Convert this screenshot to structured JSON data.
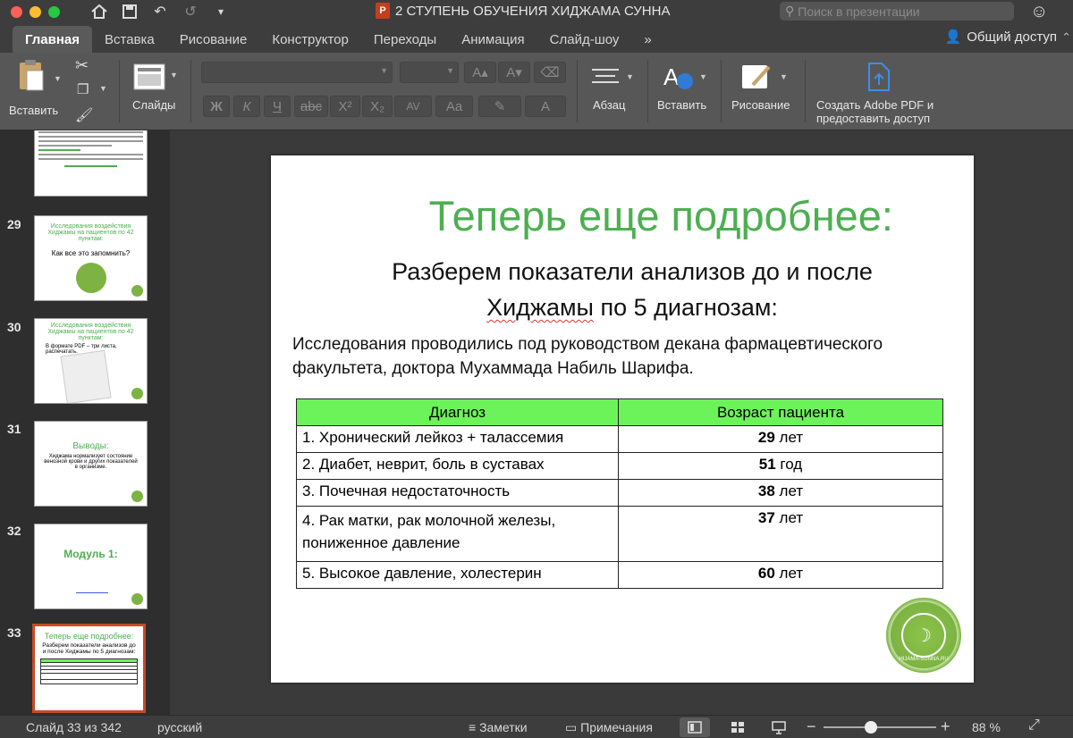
{
  "window": {
    "title": "2 СТУПЕНЬ ОБУЧЕНИЯ ХИДЖАМА СУННА",
    "app_badge": "P",
    "search_placeholder": "Поиск в презентации"
  },
  "tabs": [
    {
      "label": "Главная",
      "active": true
    },
    {
      "label": "Вставка"
    },
    {
      "label": "Рисование"
    },
    {
      "label": "Конструктор"
    },
    {
      "label": "Переходы"
    },
    {
      "label": "Анимация"
    },
    {
      "label": "Слайд-шоу"
    },
    {
      "label": "»"
    }
  ],
  "share_label": "Общий доступ",
  "ribbon": {
    "paste": "Вставить",
    "slides": "Слайды",
    "paragraph": "Абзац",
    "insert": "Вставить",
    "drawing": "Рисование",
    "adobe_line1": "Создать Adobe PDF и",
    "adobe_line2": "предоставить доступ",
    "format_buttons": [
      "Ж",
      "К",
      "Ч",
      "abc",
      "X²",
      "X₂",
      "AV",
      "Aa",
      "A"
    ]
  },
  "thumbnails": [
    {
      "num": "29",
      "title": "Исследования воздействия Хиджамы на пациентов по 42 пунктам:",
      "text": "Как все это запомнить?"
    },
    {
      "num": "30",
      "title": "Исследования воздействия Хиджамы на пациентов по 42 пунктам:",
      "text": "В формате PDF – три листа, распечатать."
    },
    {
      "num": "31",
      "title": "Выводы:",
      "text": "Хиджама нормализует состояние венозной крови и других показателей в организме."
    },
    {
      "num": "32",
      "title": "Модуль 1:",
      "text": ""
    },
    {
      "num": "33",
      "title": "Теперь еще подробнее:",
      "text": "Разберем показатели анализов до и после Хиджамы по 5 диагнозам:"
    }
  ],
  "slide": {
    "title": "Теперь еще подробнее:",
    "subtitle_line1": "Разберем показатели анализов до и после",
    "subtitle_word": "Хиджамы",
    "subtitle_rest": " по 5 диагнозам:",
    "text": "Исследования проводились под руководством декана фармацевтического факультета, доктора Мухаммада Набиль Шарифа.",
    "table": {
      "headers": [
        "Диагноз",
        "Возраст пациента"
      ],
      "rows": [
        {
          "diagnosis": "1. Хронический лейкоз + талассемия",
          "age": "29",
          "unit": " лет"
        },
        {
          "diagnosis": "2. Диабет, неврит, боль в суставах",
          "age": "51",
          "unit": " год"
        },
        {
          "diagnosis": "3. Почечная недостаточность",
          "age": "38",
          "unit": " лет"
        },
        {
          "diagnosis": "4. Рак матки, рак молочной железы, пониженное давление",
          "age": "37",
          "unit": " лет"
        },
        {
          "diagnosis": "5. Высокое давление, холестерин",
          "age": "60",
          "unit": " лет"
        }
      ]
    },
    "logo_caption": "HIJAMA-SUNNA.RU"
  },
  "status": {
    "slide_info": "Слайд 33 из 342",
    "language": "русский",
    "notes": "Заметки",
    "comments": "Примечания",
    "zoom": "88 %"
  },
  "colors": {
    "accent_green": "#4caf50",
    "header_green": "#6df35a",
    "selection": "#c74a27"
  }
}
